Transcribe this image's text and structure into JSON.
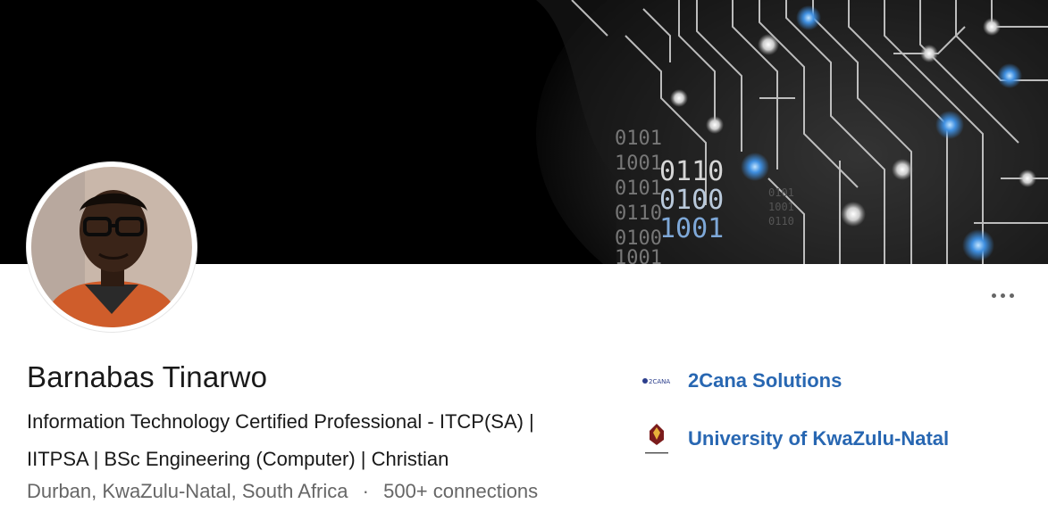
{
  "profile": {
    "name": "Barnabas Tinarwo",
    "headline_line1": "Information Technology Certified Professional - ITCP(SA) |",
    "headline_line2": "IITPSA | BSc Engineering (Computer) | Christian",
    "location": "Durban, KwaZulu-Natal, South Africa",
    "separator": "·",
    "connections": "500+ connections"
  },
  "banner": {
    "binary_lines": [
      "0101",
      "1001",
      "0101",
      "0110",
      "0100",
      "1001"
    ],
    "binary_big": [
      "0110",
      "0100",
      "1001"
    ],
    "icon": "circuit-board-banner"
  },
  "organizations": [
    {
      "name": "2Cana Solutions",
      "logo_text": "2CANA",
      "icon": "company-logo"
    },
    {
      "name": "University of KwaZulu-Natal",
      "logo_text": "UNIVERSITY OF KWAZULU-NATAL",
      "icon": "university-logo"
    }
  ],
  "actions": {
    "more_icon": "more-options-icon"
  },
  "colors": {
    "link": "#2867b2",
    "text": "#191919",
    "muted": "#666666",
    "banner_glow": "#4a90d9"
  }
}
